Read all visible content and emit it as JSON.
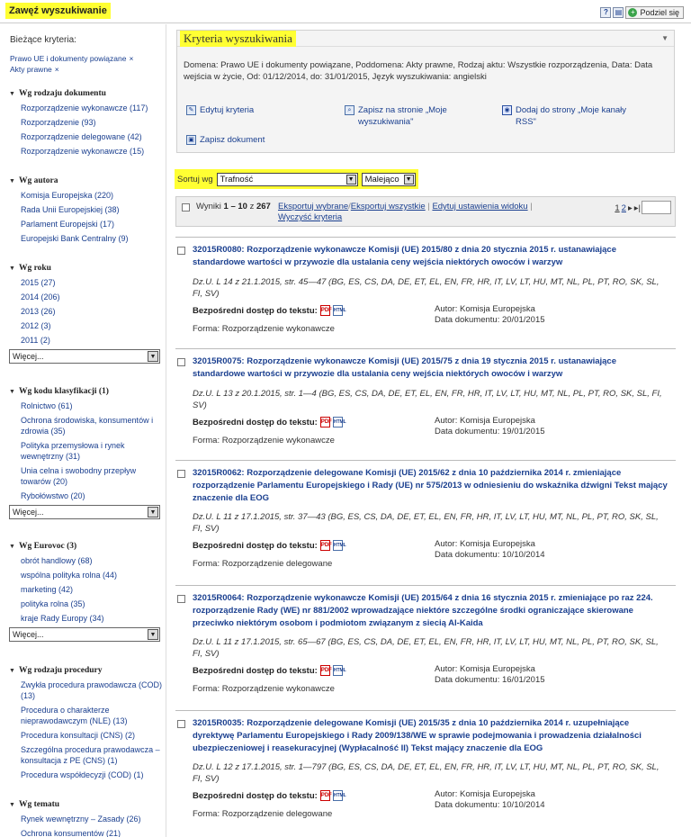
{
  "topbar": {
    "title": "Zawęź wyszukiwanie",
    "help_icon": "?",
    "print_icon": "print",
    "share_label": "Podziel się"
  },
  "sidebar": {
    "current_label": "Bieżące kryteria:",
    "current_criteria": [
      "Prawo UE i dokumenty powiązane",
      "Akty prawne"
    ],
    "remove_icon": "×",
    "more_label": "Więcej...",
    "facets": [
      {
        "title": "Wg rodzaju dokumentu",
        "items": [
          "Rozporządzenie wykonawcze (117)",
          "Rozporządzenie (93)",
          "Rozporządzenie delegowane (42)",
          "Rozporządzenie wykonawcze (15)"
        ]
      },
      {
        "title": "Wg autora",
        "items": [
          "Komisja Europejska (220)",
          "Rada Unii Europejskiej (38)",
          "Parlament Europejski (17)",
          "Europejski Bank Centralny (9)"
        ]
      },
      {
        "title": "Wg roku",
        "items": [
          "2015 (27)",
          "2014 (206)",
          "2013 (26)",
          "2012 (3)",
          "2011 (2)"
        ]
      },
      {
        "title": "Wg kodu klasyfikacji (1)",
        "items": [
          "Rolnictwo (61)",
          "Ochrona środowiska, konsumentów i zdrowia (35)",
          "Polityka przemysłowa i rynek wewnętrzny (31)",
          "Unia celna i swobodny przepływ towarów (20)",
          "Rybołówstwo (20)"
        ]
      },
      {
        "title": "Wg Eurovoc (3)",
        "items": [
          "obrót handlowy (68)",
          "wspólna polityka rolna (44)",
          "marketing (42)",
          "polityka rolna (35)",
          "kraje Rady Europy (34)"
        ]
      },
      {
        "title": "Wg rodzaju procedury",
        "items": [
          "Zwykła procedura prawodawcza (COD) (13)",
          "Procedura o charakterze nieprawodawczym (NLE) (13)",
          "Procedura konsultacji (CNS) (2)",
          "Szczególna procedura prawodawcza – konsultacja z PE (CNS) (1)",
          "Procedura współdecyzji (COD) (1)"
        ]
      },
      {
        "title": "Wg tematu",
        "items": [
          "Rynek wewnętrzny – Zasady (26)",
          "Ochrona konsumentów (21)"
        ]
      }
    ]
  },
  "criteria": {
    "title": "Kryteria wyszukiwania",
    "description": "Domena: Prawo UE i dokumenty powiązane, Poddomena: Akty prawne, Rodzaj aktu: Wszystkie rozporządzenia, Data: Data wejścia w życie, Od: 01/12/2014, do: 31/01/2015, Język wyszukiwania: angielski",
    "edit_label": "Edytuj kryteria",
    "save_search_label": "Zapisz na stronie „Moje wyszukiwania\"",
    "rss_label": "Dodaj do strony „Moje kanały RSS\"",
    "save_doc_label": "Zapisz dokument"
  },
  "sort": {
    "label": "Sortuj wg",
    "field": "Trafność",
    "order": "Malejąco"
  },
  "results_toolbar": {
    "results_prefix": "Wyniki",
    "range": "1 – 10",
    "of_label": "z",
    "total": "267",
    "export_selected": "Eksportuj wybrane",
    "export_all": "Eksportuj wszystkie",
    "edit_view": "Edytuj ustawienia widoku",
    "clear_criteria": "Wyczyść kryteria",
    "page_current": "1",
    "page_next": "2",
    "next_icon": "▸",
    "last_icon": "▸|"
  },
  "results": [
    {
      "title": "32015R0080: Rozporządzenie wykonawcze Komisji (UE) 2015/80 z dnia 20 stycznia 2015 r. ustanawiające standardowe wartości w przywozie dla ustalania ceny wejścia niektórych owoców i warzyw",
      "reference": "Dz.U. L 14 z 21.1.2015, str. 45—47 (BG, ES, CS, DA, DE, ET, EL, EN, FR, HR, IT, LV, LT, HU, MT, NL, PL, PT, RO, SK, SL, FI, SV)",
      "access_label": "Bezpośredni dostęp do tekstu:",
      "form": "Forma: Rozporządzenie wykonawcze",
      "author": "Autor: Komisja Europejska",
      "date": "Data dokumentu: 20/01/2015"
    },
    {
      "title": "32015R0075: Rozporządzenie wykonawcze Komisji (UE) 2015/75 z dnia 19 stycznia 2015 r. ustanawiające standardowe wartości w przywozie dla ustalania ceny wejścia niektórych owoców i warzyw",
      "reference": "Dz.U. L 13 z 20.1.2015, str. 1—4 (BG, ES, CS, DA, DE, ET, EL, EN, FR, HR, IT, LV, LT, HU, MT, NL, PL, PT, RO, SK, SL, FI, SV)",
      "access_label": "Bezpośredni dostęp do tekstu:",
      "form": "Forma: Rozporządzenie wykonawcze",
      "author": "Autor: Komisja Europejska",
      "date": "Data dokumentu: 19/01/2015"
    },
    {
      "title": "32015R0062: Rozporządzenie delegowane Komisji (UE) 2015/62 z dnia 10 października 2014 r. zmieniające rozporządzenie Parlamentu Europejskiego i Rady (UE) nr 575/2013 w odniesieniu do wskaźnika dźwigni Tekst mający znaczenie dla EOG",
      "reference": "Dz.U. L 11 z 17.1.2015, str. 37—43 (BG, ES, CS, DA, DE, ET, EL, EN, FR, HR, IT, LV, LT, HU, MT, NL, PL, PT, RO, SK, SL, FI, SV)",
      "access_label": "Bezpośredni dostęp do tekstu:",
      "form": "Forma: Rozporządzenie delegowane",
      "author": "Autor: Komisja Europejska",
      "date": "Data dokumentu: 10/10/2014"
    },
    {
      "title": "32015R0064: Rozporządzenie wykonawcze Komisji (UE) 2015/64 z dnia 16 stycznia 2015 r. zmieniające po raz 224. rozporządzenie Rady (WE) nr 881/2002 wprowadzające niektóre szczególne środki ograniczające skierowane przeciwko niektórym osobom i podmiotom związanym z siecią Al-Kaida",
      "reference": "Dz.U. L 11 z 17.1.2015, str. 65—67 (BG, ES, CS, DA, DE, ET, EL, EN, FR, HR, IT, LV, LT, HU, MT, NL, PL, PT, RO, SK, SL, FI, SV)",
      "access_label": "Bezpośredni dostęp do tekstu:",
      "form": "Forma: Rozporządzenie wykonawcze",
      "author": "Autor: Komisja Europejska",
      "date": "Data dokumentu: 16/01/2015"
    },
    {
      "title": "32015R0035: Rozporządzenie delegowane Komisji (UE) 2015/35 z dnia 10 października 2014 r. uzupełniające dyrektywę Parlamentu Europejskiego i Rady 2009/138/WE w sprawie podejmowania i prowadzenia działalności ubezpieczeniowej i reasekuracyjnej (Wypłacalność II) Tekst mający znaczenie dla EOG",
      "reference": "Dz.U. L 12 z 17.1.2015, str. 1—797 (BG, ES, CS, DA, DE, ET, EL, EN, FR, HR, IT, LV, LT, HU, MT, NL, PL, PT, RO, SK, SL, FI, SV)",
      "access_label": "Bezpośredni dostęp do tekstu:",
      "form": "Forma: Rozporządzenie delegowane",
      "author": "Autor: Komisja Europejska",
      "date": "Data dokumentu: 10/10/2014"
    }
  ],
  "icons": {
    "pdf": "pdf-icon",
    "html": "html-icon",
    "edit": "pencil-icon",
    "save_search": "search-save-icon",
    "rss": "rss-icon",
    "save_doc": "save-icon"
  },
  "colors": {
    "highlight": "#ffff33",
    "link": "#1a3f8f"
  }
}
